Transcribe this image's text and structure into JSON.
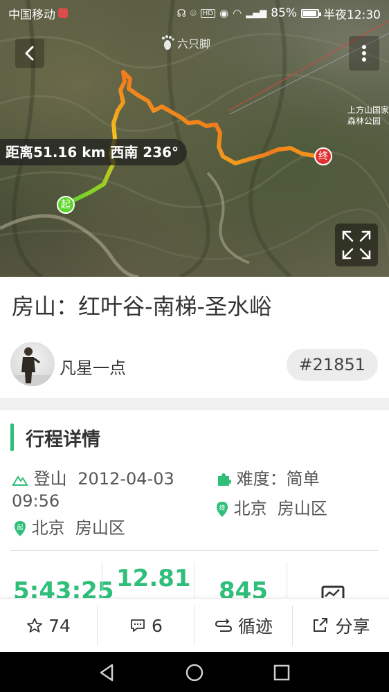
{
  "status_bar": {
    "carrier": "中国移动",
    "battery": "85%",
    "time": "半夜12:30",
    "battery_level": 0.85,
    "network": "4G"
  },
  "map": {
    "brand": "六只脚",
    "distance_label": "距离51.16 km 西南 236°",
    "place_label": "上方山国家森林公园",
    "start_marker": "起",
    "end_marker": "终"
  },
  "route": {
    "title": "房山：红叶谷-南梯-圣水峪",
    "author": "凡星一点",
    "id": "#21851"
  },
  "details": {
    "section_title": "行程详情",
    "date_label": "登山",
    "date_value": "2012-04-03",
    "time_value": "09:56",
    "difficulty_label": "难度：",
    "difficulty_value": "简单",
    "start_location": "北京  房山区",
    "end_location": "北京  房山区"
  },
  "stats": {
    "duration": "5:43:25",
    "distance": "12.81",
    "elevation": "845"
  },
  "actions": {
    "likes": "74",
    "comments": "6",
    "track_label": "循迹",
    "share_label": "分享"
  },
  "colors": {
    "accent": "#2fbf7a",
    "route_start": "#5bd62b",
    "route_mid": "#f4c21d",
    "route_high": "#f07a1c",
    "end_marker": "#e03131"
  },
  "icons": [
    "back-arrow-icon",
    "more-vertical-icon",
    "footprint-icon",
    "fullscreen-icon",
    "mountain-icon",
    "puzzle-icon",
    "location-pin-icon",
    "star-icon",
    "comment-icon",
    "track-icon",
    "share-icon",
    "nav-back-icon",
    "nav-home-icon",
    "nav-recent-icon"
  ]
}
